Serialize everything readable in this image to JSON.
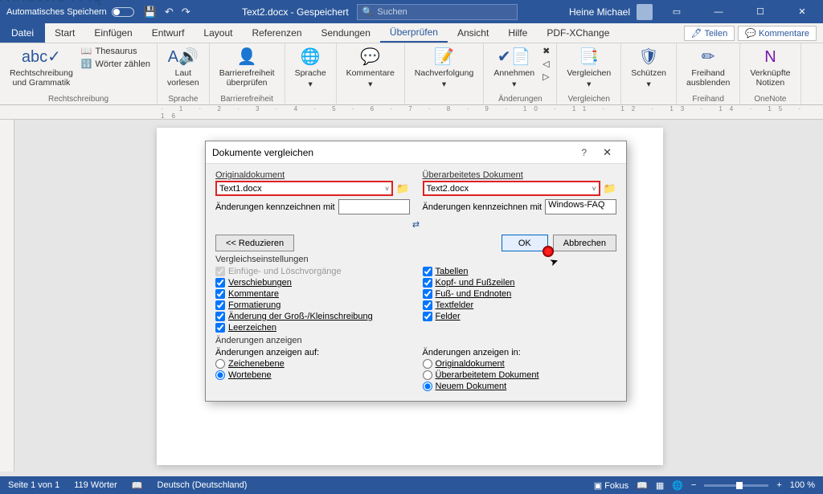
{
  "watermark": "Windows-FAQ",
  "titlebar": {
    "autosave": "Automatisches Speichern",
    "doc": "Text2.docx - Gespeichert",
    "search_placeholder": "Suchen",
    "user": "Heine Michael"
  },
  "menu": {
    "file": "Datei",
    "items": [
      "Start",
      "Einfügen",
      "Entwurf",
      "Layout",
      "Referenzen",
      "Sendungen",
      "Überprüfen",
      "Ansicht",
      "Hilfe",
      "PDF-XChange"
    ],
    "share": "Teilen",
    "comments": "Kommentare"
  },
  "ribbon": {
    "g1": {
      "spell": "Rechtschreibung\nund Grammatik",
      "thes": "Thesaurus",
      "count": "Wörter zählen",
      "label": "Rechtschreibung"
    },
    "g2": {
      "read": "Laut\nvorlesen",
      "label": "Sprache"
    },
    "g3": {
      "acc": "Barrierefreiheit\nüberprüfen",
      "label": "Barrierefreiheit"
    },
    "g4": {
      "lang": "Sprache"
    },
    "g5": {
      "comm": "Kommentare"
    },
    "g6": {
      "track": "Nachverfolgung"
    },
    "g7": {
      "accept": "Annehmen",
      "label": "Änderungen"
    },
    "g8": {
      "compare": "Vergleichen",
      "label": "Vergleichen"
    },
    "g9": {
      "protect": "Schützen"
    },
    "g10": {
      "ink": "Freihand\nausblenden",
      "label": "Freihand"
    },
    "g11": {
      "note": "Verknüpfte\nNotizen",
      "label": "OneNote"
    }
  },
  "dialog": {
    "title": "Dokumente vergleichen",
    "orig_lbl": "Originaldokument",
    "orig_val": "Text1.docx",
    "rev_lbl": "Überarbeitetes Dokument",
    "rev_val": "Text2.docx",
    "mark_lbl": "Änderungen kennzeichnen mit",
    "mark_val2": "Windows-FAQ",
    "reduce": "<< Reduzieren",
    "ok": "OK",
    "cancel": "Abbrechen",
    "settings_hdr": "Vergleichseinstellungen",
    "chk_insert": "Einfüge- und Löschvorgänge",
    "chk_moves": "Verschiebungen",
    "chk_comments": "Kommentare",
    "chk_format": "Formatierung",
    "chk_case": "Änderung der Groß-/Kleinschreibung",
    "chk_space": "Leerzeichen",
    "chk_tables": "Tabellen",
    "chk_headers": "Kopf- und Fußzeilen",
    "chk_foot": "Fuß- und Endnoten",
    "chk_textbox": "Textfelder",
    "chk_fields": "Felder",
    "show_hdr": "Änderungen anzeigen",
    "show_at": "Änderungen anzeigen auf:",
    "rad_char": "Zeichenebene",
    "rad_word": "Wortebene",
    "show_in": "Änderungen anzeigen in:",
    "rad_orig": "Originaldokument",
    "rad_rev": "Überarbeitetem Dokument",
    "rad_new": "Neuem Dokument"
  },
  "status": {
    "page": "Seite 1 von 1",
    "words": "119 Wörter",
    "lang": "Deutsch (Deutschland)",
    "focus": "Fokus",
    "zoom": "100 %"
  }
}
